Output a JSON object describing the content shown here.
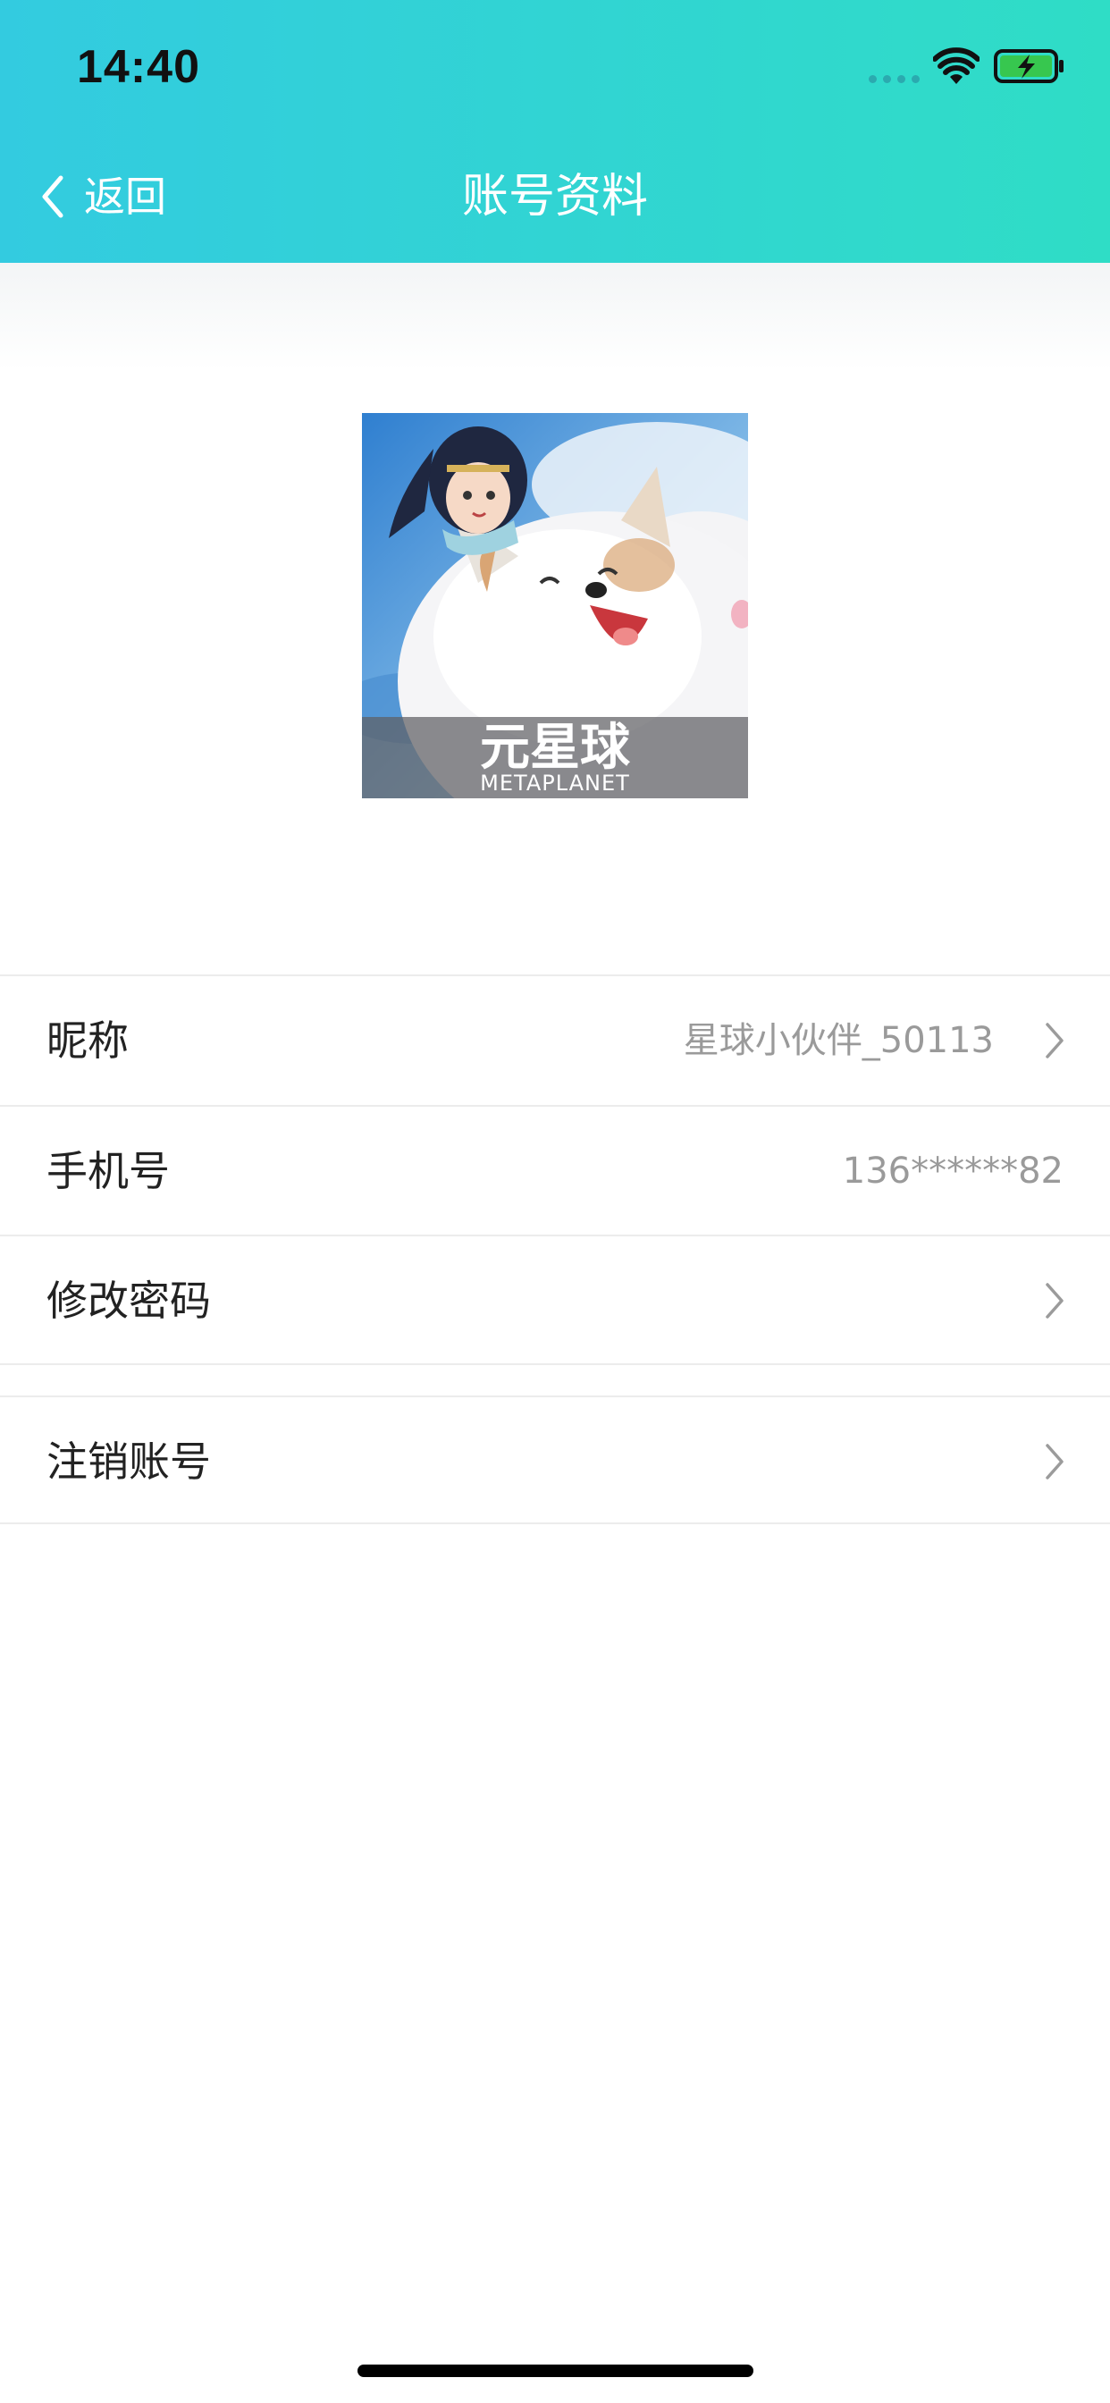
{
  "status_bar": {
    "time": "14:40"
  },
  "nav": {
    "back_label": "返回",
    "title": "账号资料"
  },
  "avatar": {
    "brand_cn": "元星球",
    "brand_en": "METAPLANET"
  },
  "settings": {
    "nickname": {
      "label": "昵称",
      "value": "星球小伙伴_50113"
    },
    "phone": {
      "label": "手机号",
      "value": "136******82"
    },
    "change_password": {
      "label": "修改密码"
    },
    "delete_account": {
      "label": "注销账号"
    }
  },
  "colors": {
    "header_gradient_start": "#33cbe0",
    "header_gradient_end": "#2fddc6",
    "battery_green": "#37c74f"
  }
}
